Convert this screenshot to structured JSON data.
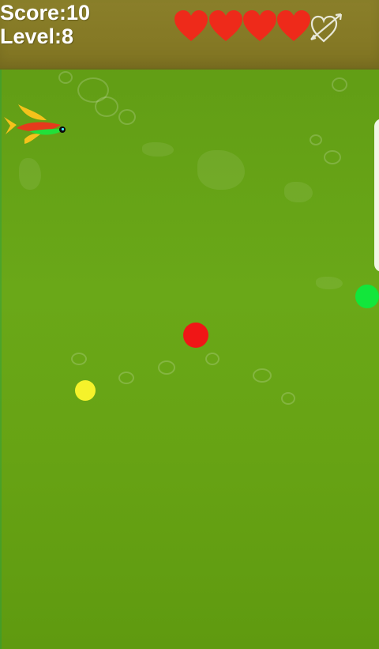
{
  "hud": {
    "score_text": "Score:10",
    "level_text": "Level:8",
    "lives_icons": [
      "heart-icon",
      "heart-icon",
      "heart-icon",
      "heart-icon"
    ],
    "bonus_icon": "heart-arrow-icon"
  },
  "player": {
    "icon": "fish-icon"
  },
  "collectibles": [
    {
      "color": "#f01616"
    },
    {
      "color": "#f5f22b"
    },
    {
      "color": "#12e63b"
    }
  ],
  "colors": {
    "water": "#6aa818",
    "hud_bar": "#857925",
    "heart": "#ee2a1a",
    "hud_text": "#ffffff"
  }
}
